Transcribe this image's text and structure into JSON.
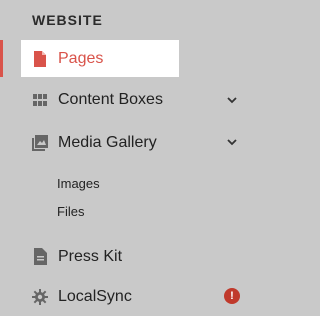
{
  "sidebar": {
    "section_title": "WEBSITE",
    "accent_color": "#d9534a",
    "items": [
      {
        "label": "Pages",
        "icon": "page-icon",
        "active": true
      },
      {
        "label": "Content Boxes",
        "icon": "grid-icon",
        "expandable": true
      },
      {
        "label": "Media Gallery",
        "icon": "gallery-icon",
        "expandable": true,
        "subitems": [
          {
            "label": "Images"
          },
          {
            "label": "Files"
          }
        ]
      },
      {
        "label": "Press Kit",
        "icon": "document-icon"
      },
      {
        "label": "LocalSync",
        "icon": "gear-icon",
        "alert": "!"
      }
    ]
  }
}
